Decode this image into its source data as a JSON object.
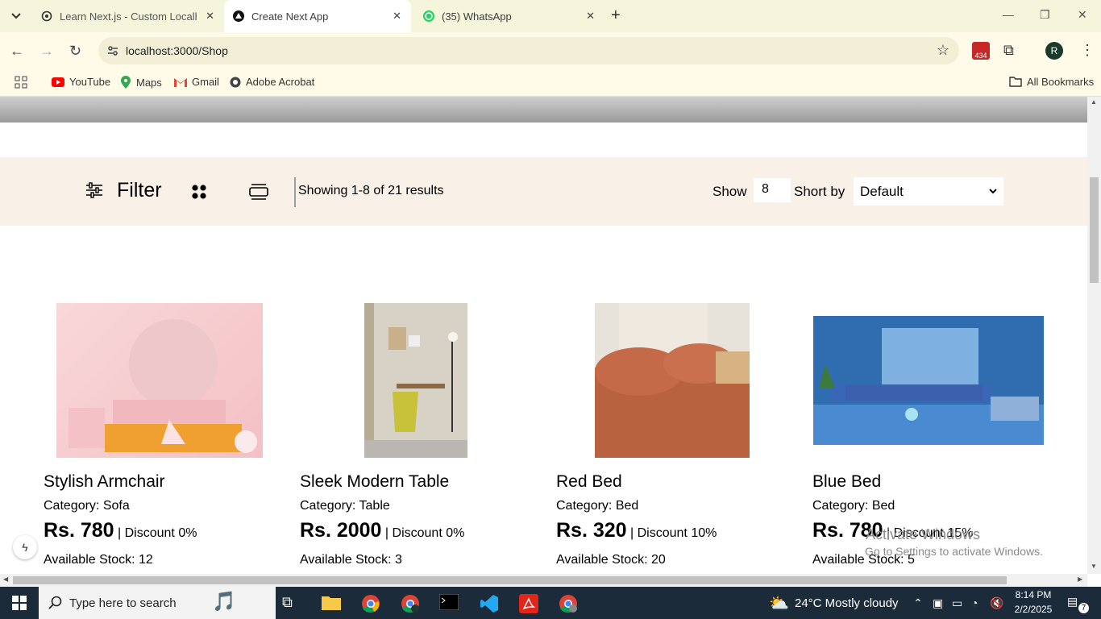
{
  "browser": {
    "tabs": [
      {
        "title": "Learn Next.js - Custom Localho",
        "icon": "openai-icon"
      },
      {
        "title": "Create Next App",
        "icon": "nextjs-icon",
        "active": true
      },
      {
        "title": "(35) WhatsApp",
        "icon": "whatsapp-icon"
      }
    ],
    "url": "localhost:3000/Shop",
    "extension_badge": "434",
    "profile_initial": "R",
    "bookmarks": [
      {
        "label": "YouTube",
        "icon": "youtube-icon"
      },
      {
        "label": "Maps",
        "icon": "maps-icon"
      },
      {
        "label": "Gmail",
        "icon": "gmail-icon"
      },
      {
        "label": "Adobe Acrobat",
        "icon": "acrobat-icon"
      }
    ],
    "all_bookmarks": "All Bookmarks"
  },
  "shop": {
    "filter_label": "Filter",
    "results_text": "Showing 1-8 of 21 results",
    "show_label": "Show",
    "show_value": "8",
    "sort_label": "Short by",
    "sort_value": "Default",
    "products": [
      {
        "name": "Stylish Armchair",
        "category": "Category: Sofa",
        "price": "Rs. 780",
        "discount": "| Discount 0%",
        "stock": "Available Stock: 12"
      },
      {
        "name": "Sleek Modern Table",
        "category": "Category: Table",
        "price": "Rs. 2000",
        "discount": "| Discount 0%",
        "stock": "Available Stock: 3"
      },
      {
        "name": "Red Bed",
        "category": "Category: Bed",
        "price": "Rs. 320",
        "discount": "| Discount 10%",
        "stock": "Available Stock: 20"
      },
      {
        "name": "Blue Bed",
        "category": "Category: Bed",
        "price": "Rs. 780",
        "discount": "| Discount 15%",
        "stock": "Available Stock: 5"
      }
    ]
  },
  "watermark": {
    "line1": "Activate Windows",
    "line2": "Go to Settings to activate Windows."
  },
  "taskbar": {
    "search_placeholder": "Type here to search",
    "weather": "24°C  Mostly cloudy",
    "time": "8:14 PM",
    "date": "2/2/2025",
    "notification_count": "7"
  },
  "colors": {
    "chrome_frame": "#f5f5dc",
    "filter_bar": "#f9f1e7",
    "taskbar": "#1c2b3a"
  }
}
